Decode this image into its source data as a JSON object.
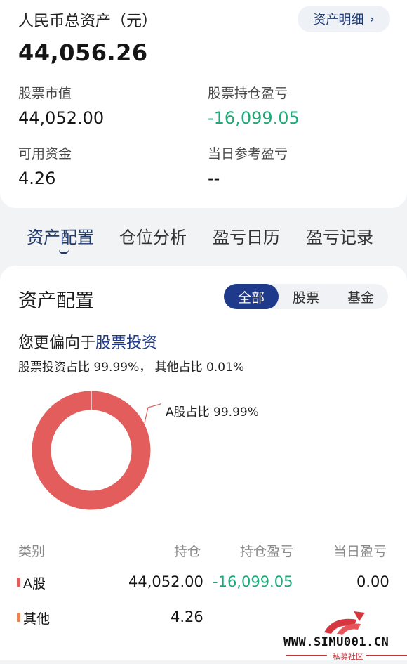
{
  "summary": {
    "total_label": "人民币总资产（元）",
    "total_value": "44,056.26",
    "detail_button": "资产明细",
    "stock_market_value_label": "股票市值",
    "stock_market_value": "44,052.00",
    "holding_pnl_label": "股票持仓盈亏",
    "holding_pnl": "-16,099.05",
    "available_cash_label": "可用资金",
    "available_cash": "4.26",
    "daily_pnl_label": "当日参考盈亏",
    "daily_pnl": "--"
  },
  "tabs": [
    {
      "label": "资产配置",
      "active": true
    },
    {
      "label": "仓位分析",
      "active": false
    },
    {
      "label": "盈亏日历",
      "active": false
    },
    {
      "label": "盈亏记录",
      "active": false
    }
  ],
  "allocation": {
    "title": "资产配置",
    "segments": [
      {
        "label": "全部",
        "active": true
      },
      {
        "label": "股票",
        "active": false
      },
      {
        "label": "基金",
        "active": false
      }
    ],
    "preference_prefix": "您更偏向于",
    "preference_highlight": "股票投资",
    "ratio_text": "股票投资占比 99.99%， 其他占比 0.01%",
    "donut_label": "A股占比 99.99%",
    "donut_share": 0.9999,
    "colors": {
      "a_share": "#e35d5d",
      "other": "#e8845a",
      "accent": "#1f3a8a",
      "gain": "#1eaa78"
    }
  },
  "table": {
    "headers": [
      "类别",
      "持仓",
      "持仓盈亏",
      "当日盈亏"
    ],
    "rows": [
      {
        "category": "A股",
        "holding": "44,052.00",
        "holding_pnl": "-16,099.05",
        "daily_pnl": "0.00"
      },
      {
        "category": "其他",
        "holding": "4.26",
        "holding_pnl": "",
        "daily_pnl": ""
      }
    ]
  },
  "watermark": {
    "text": "WWW.SIMU001.CN",
    "sub": "私募社区"
  }
}
